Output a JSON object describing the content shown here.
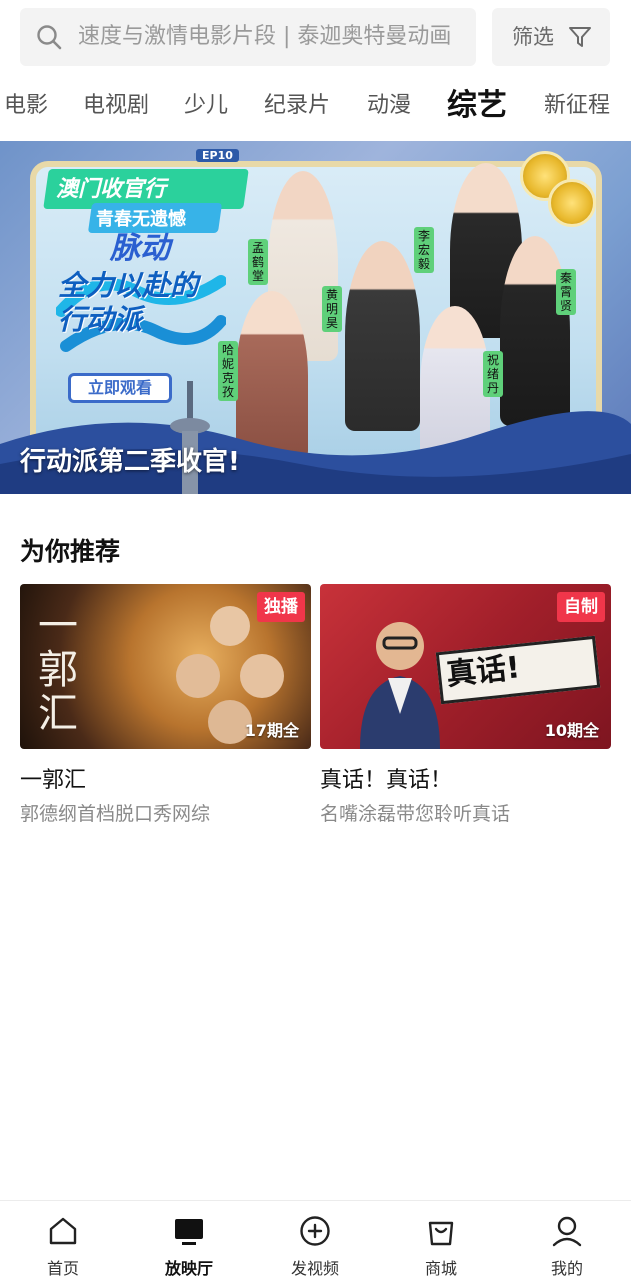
{
  "search": {
    "placeholder": "速度与激情电影片段 | 泰迦奥特曼动画",
    "filter_label": "筛选"
  },
  "tabs": [
    {
      "label": "电影",
      "active": false
    },
    {
      "label": "电视剧",
      "active": false
    },
    {
      "label": "少儿",
      "active": false
    },
    {
      "label": "纪录片",
      "active": false
    },
    {
      "label": "动漫",
      "active": false
    },
    {
      "label": "综艺",
      "active": true
    },
    {
      "label": "新征程",
      "active": false
    }
  ],
  "banner": {
    "ep_tag": "EP10",
    "logo_line1": "澳门收官行",
    "logo_line2": "青春无遗憾",
    "brand": "脉动",
    "show_name": "全力以赴的行动派",
    "watch_button": "立即观看",
    "cast": [
      "孟鹤堂",
      "李宏毅",
      "黄明昊",
      "秦霄贤",
      "哈妮克孜",
      "祝绪丹"
    ],
    "caption": "行动派第二季收官!"
  },
  "recommend": {
    "title": "为你推荐",
    "cards": [
      {
        "name": "一郭汇",
        "desc": "郭德纲首档脱口秀网综",
        "badge": "独播",
        "episodes": "17期全",
        "poster_text": "一郭汇"
      },
      {
        "name": "真话！真话！",
        "desc": "名嘴涂磊带您聆听真话",
        "badge": "自制",
        "episodes": "10期全",
        "poster_text": "真话!"
      }
    ]
  },
  "bottom_nav": [
    {
      "label": "首页",
      "icon": "home-icon",
      "active": false
    },
    {
      "label": "放映厅",
      "icon": "tv-icon",
      "active": true
    },
    {
      "label": "发视频",
      "icon": "add-circle-icon",
      "active": false
    },
    {
      "label": "商城",
      "icon": "shopping-bag-icon",
      "active": false
    },
    {
      "label": "我的",
      "icon": "person-icon",
      "active": false
    }
  ],
  "colors": {
    "badge_red": "#f0364a",
    "search_bg": "#f3f3f3",
    "placeholder_gray": "#9a9a9a"
  }
}
